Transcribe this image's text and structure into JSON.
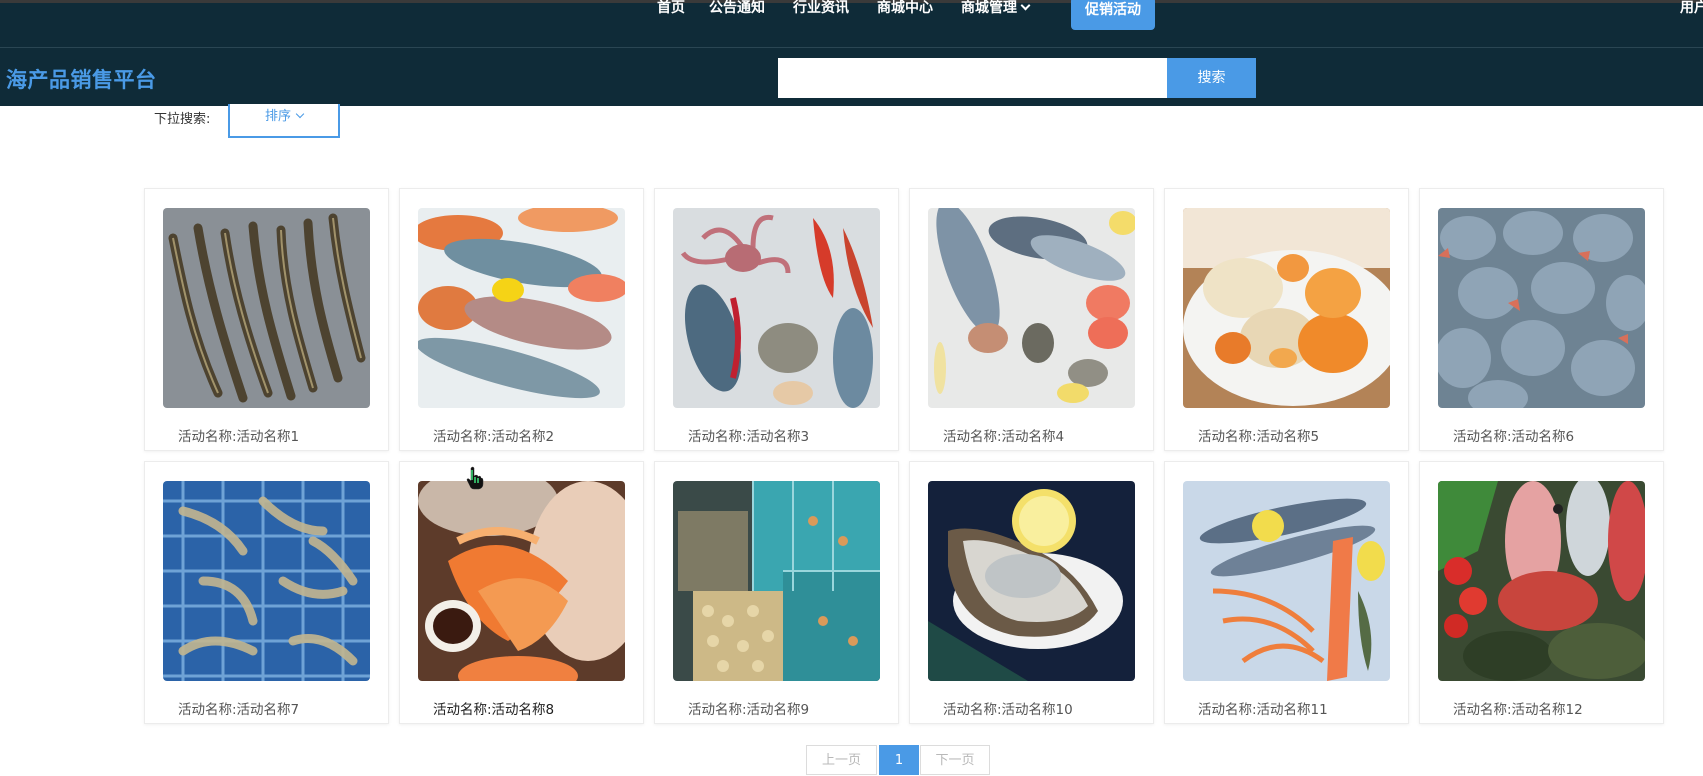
{
  "header": {
    "nav": [
      {
        "label": "首页"
      },
      {
        "label": "公告通知"
      },
      {
        "label": "行业资讯"
      },
      {
        "label": "商城中心"
      },
      {
        "label": "商城管理"
      }
    ],
    "promo_label": "促销活动",
    "user_label": "用户",
    "brand": "海产品销售平台",
    "search": {
      "value": "",
      "placeholder": "",
      "button_label": "搜索"
    }
  },
  "filter": {
    "label": "下拉搜索:",
    "sort_label": "排序"
  },
  "products": [
    {
      "caption": "活动名称:活动名称1",
      "image": "tiger-prawns"
    },
    {
      "caption": "活动名称:活动名称2",
      "image": "fish-on-ice-with-lemon"
    },
    {
      "caption": "活动名称:活动名称3",
      "image": "octopus-lobster-seafood-platter"
    },
    {
      "caption": "活动名称:活动名称4",
      "image": "fish-salmon-oysters-lemon"
    },
    {
      "caption": "活动名称:活动名称5",
      "image": "crabs-on-plate"
    },
    {
      "caption": "活动名称:活动名称6",
      "image": "pomfret-fish-pile"
    },
    {
      "caption": "活动名称:活动名称7",
      "image": "shrimp-in-blue-basket"
    },
    {
      "caption": "活动名称:活动名称8",
      "image": "hand-holding-cooked-shrimp"
    },
    {
      "caption": "活动名称:活动名称9",
      "image": "seafood-market-tanks"
    },
    {
      "caption": "活动名称:活动名称10",
      "image": "oyster-with-lemon"
    },
    {
      "caption": "活动名称:活动名称11",
      "image": "mackerel-salmon-prawns"
    },
    {
      "caption": "活动名称:活动名称12",
      "image": "red-fish-and-vegetables"
    }
  ],
  "pagination": {
    "prev_label": "上一页",
    "current": "1",
    "next_label": "下一页"
  },
  "colors": {
    "header_bg": "#0f2b38",
    "accent": "#4a9ae6"
  }
}
